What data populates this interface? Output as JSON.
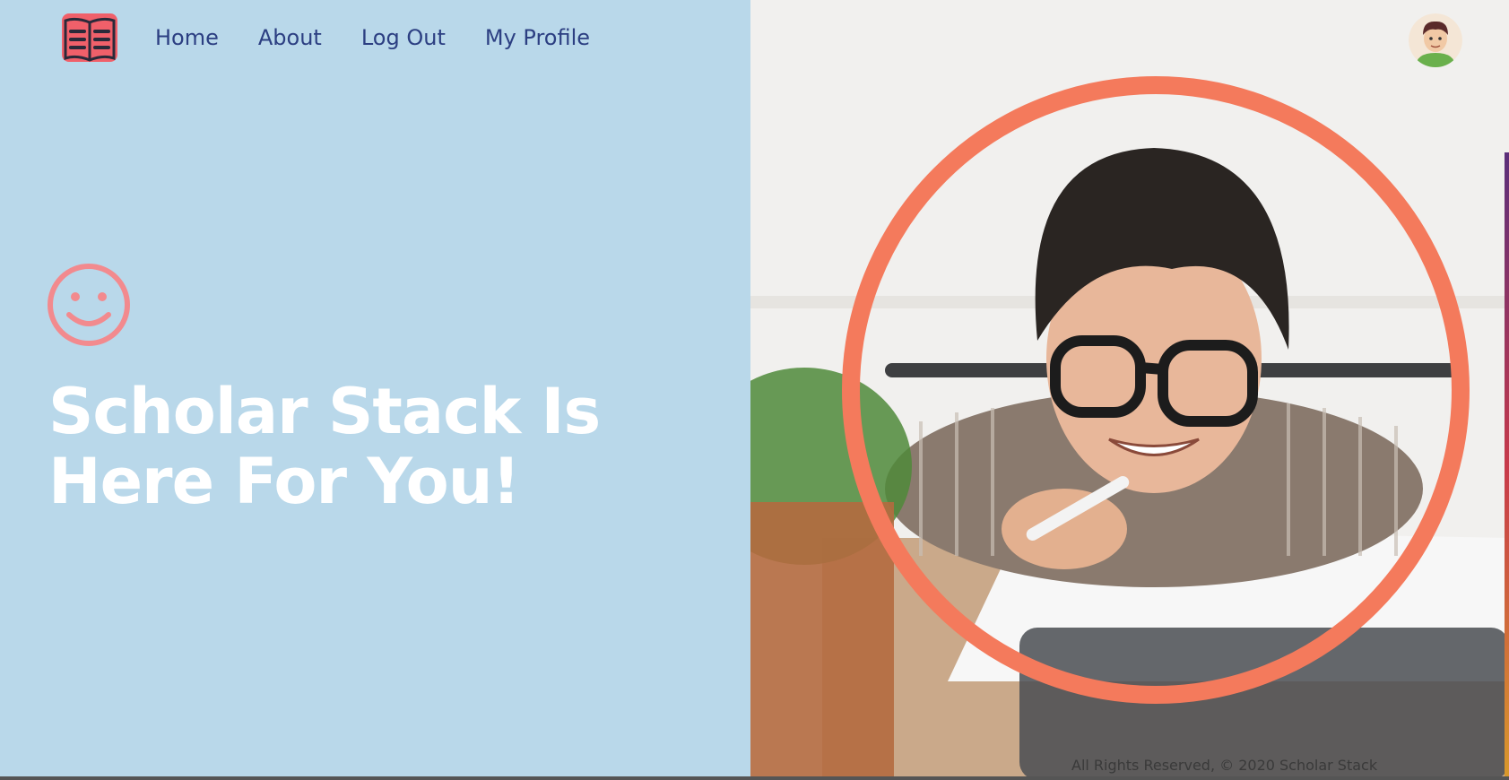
{
  "nav": {
    "logo_icon": "open-book-icon",
    "links": [
      "Home",
      "About",
      "Log Out",
      "My Profile"
    ]
  },
  "hero": {
    "icon": "smiley-face-icon",
    "title_line1": "Scholar Stack Is",
    "title_line2": "Here For You!"
  },
  "user": {
    "avatar_icon": "user-avatar-icon"
  },
  "image": {
    "description_icon": "child-with-glasses-photo"
  },
  "footer": {
    "text": "All Rights Reserved, © 2020 Scholar Stack"
  },
  "colors": {
    "left_bg": "#b9d8ea",
    "nav_text": "#2c3f82",
    "accent": "#f47a5c",
    "smiley": "#f28a8e",
    "logo": "#f0606a"
  }
}
